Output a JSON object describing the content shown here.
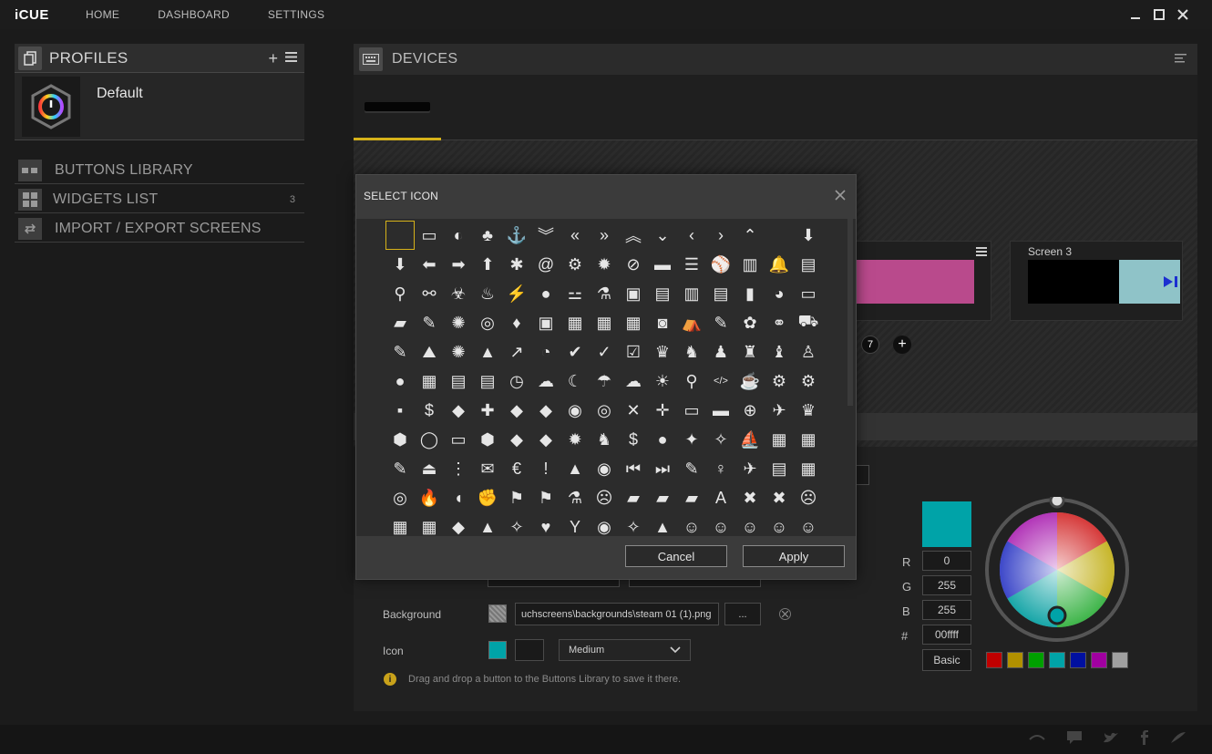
{
  "app": {
    "logo": "iCUE",
    "nav": [
      "HOME",
      "DASHBOARD",
      "SETTINGS"
    ]
  },
  "profiles": {
    "title": "PROFILES",
    "items": [
      {
        "name": "Default"
      }
    ]
  },
  "library": [
    {
      "label": "BUTTONS LIBRARY",
      "count": ""
    },
    {
      "label": "WIDGETS LIST",
      "count": "3"
    },
    {
      "label": "IMPORT / EXPORT SCREENS",
      "count": ""
    }
  ],
  "devices": {
    "title": "DEVICES",
    "screen3_title": "Screen 3",
    "page_number": "7"
  },
  "properties": {
    "background_label": "Background",
    "background_path": "uchscreens\\backgrounds\\steam 01 (1).png",
    "browse_label": "...",
    "icon_label": "Icon",
    "size_option": "Medium",
    "hint": "Drag and drop a button to the Buttons Library to save it there."
  },
  "color": {
    "r_label": "R",
    "r": "0",
    "g_label": "G",
    "g": "255",
    "b_label": "B",
    "b": "255",
    "hex_label": "#",
    "hex": "00ffff",
    "mode_button": "Basic",
    "current": "#00a3a8",
    "presets": [
      "#c00000",
      "#b09000",
      "#00a000",
      "#00a3a8",
      "#0010a0",
      "#a000a0",
      "#a0a0a0"
    ]
  },
  "modal": {
    "title": "SELECT ICON",
    "cancel": "Cancel",
    "apply": "Apply",
    "icons": [
      "",
      "▭",
      "◐",
      "♣",
      "⚓",
      "︾",
      "«",
      "»",
      "︽",
      "⌄",
      "‹",
      "›",
      "⌃",
      "",
      "⬇",
      "⬇",
      "⬅",
      "➡",
      "⬆",
      "✱",
      "@",
      "⚙",
      "✹",
      "⊘",
      "▬",
      "☰",
      "⚾",
      "▥",
      "🔔",
      "▤",
      "⚲",
      "⚯",
      "☣",
      "♨",
      "⚡",
      "●",
      "⚍",
      "⚗",
      "▣",
      "▤",
      "▥",
      "▤",
      "▮",
      "◕",
      "▭",
      "▰",
      "✎",
      "✺",
      "◎",
      "♦",
      "▣",
      "▦",
      "▦",
      "▦",
      "◙",
      "⛺",
      "✎",
      "✿",
      "⚭",
      "⛟",
      "✎",
      "⛰",
      "✺",
      "▲",
      "↗",
      "◔",
      "✔",
      "✓",
      "☑",
      "♛",
      "♞",
      "♟",
      "♜",
      "♝",
      "♙",
      "●",
      "▦",
      "▤",
      "▤",
      "◷",
      "☁",
      "☾",
      "☂",
      "☁",
      "☀",
      "⚲",
      "</>",
      "☕",
      "⚙",
      "⚙",
      "▪",
      "$",
      "◆",
      "✚",
      "◆",
      "◆",
      "◉",
      "◎",
      "✕",
      "✛",
      "▭",
      "▬",
      "⊕",
      "✈",
      "♛",
      "⬢",
      "◯",
      "▭",
      "⬢",
      "◆",
      "◆",
      "✹",
      "♞",
      "$",
      "●",
      "✦",
      "✧",
      "⛵",
      "▦",
      "▦",
      "✎",
      "⏏",
      "⋮",
      "✉",
      "€",
      "!",
      "▲",
      "◉",
      "⏮",
      "⏭",
      "✎",
      "♀",
      "✈",
      "▤",
      "▦",
      "◎",
      "🔥",
      "◖",
      "✊",
      "⚑",
      "⚑",
      "⚗",
      "☹",
      "▰",
      "▰",
      "▰",
      "A",
      "✖",
      "✖",
      "☹",
      "▦",
      "▦",
      "◆",
      "▲",
      "✧",
      "♥",
      "Y",
      "◉",
      "✧",
      "▲",
      "☺",
      "☺",
      "☺",
      "☺",
      "☺"
    ]
  }
}
